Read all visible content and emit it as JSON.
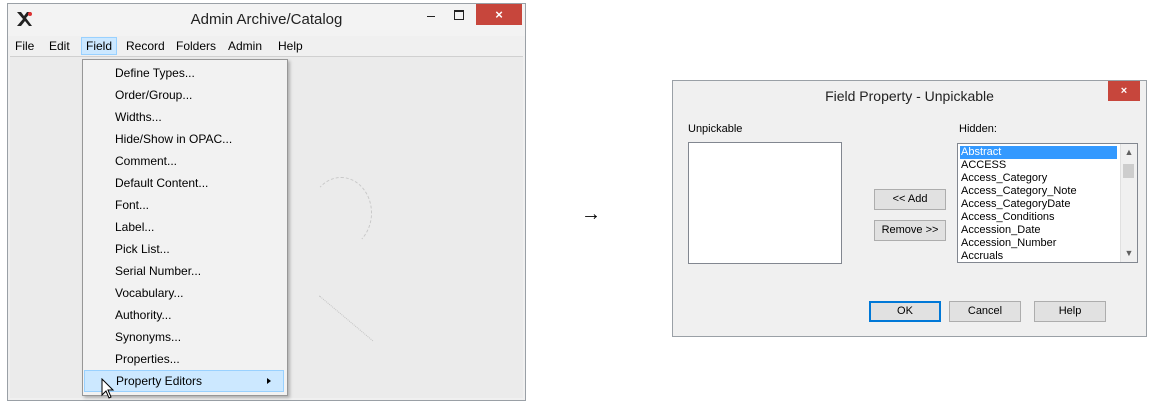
{
  "left_window": {
    "title": "Admin Archive/Catalog",
    "close_glyph": "×",
    "menu": [
      "File",
      "Edit",
      "Field",
      "Record",
      "Folders",
      "Admin",
      "Help"
    ],
    "active_menu": "Field",
    "dropdown": [
      "Define Types...",
      "Order/Group...",
      "Widths...",
      "Hide/Show in OPAC...",
      "Comment...",
      "Default Content...",
      "Font...",
      "Label...",
      "Pick List...",
      "Serial Number...",
      "Vocabulary...",
      "Authority...",
      "Synonyms...",
      "Properties...",
      "Property Editors"
    ],
    "highlighted_item": "Property Editors"
  },
  "arrow": "→",
  "dialog": {
    "title": "Field Property - Unpickable",
    "close_glyph": "×",
    "left_label": "Unpickable",
    "right_label": "Hidden:",
    "hidden_items": [
      "Abstract",
      "ACCESS",
      "Access_Category",
      "Access_Category_Note",
      "Access_CategoryDate",
      "Access_Conditions",
      "Accession_Date",
      "Accession_Number",
      "Accruals"
    ],
    "selected_item": "Abstract",
    "add_button": "<< Add",
    "remove_button": "Remove >>",
    "ok_button": "OK",
    "cancel_button": "Cancel",
    "help_button": "Help"
  },
  "colors": {
    "close_red": "#c7463c",
    "menu_highlight": "#cce8ff",
    "selection_blue": "#3399ff"
  }
}
